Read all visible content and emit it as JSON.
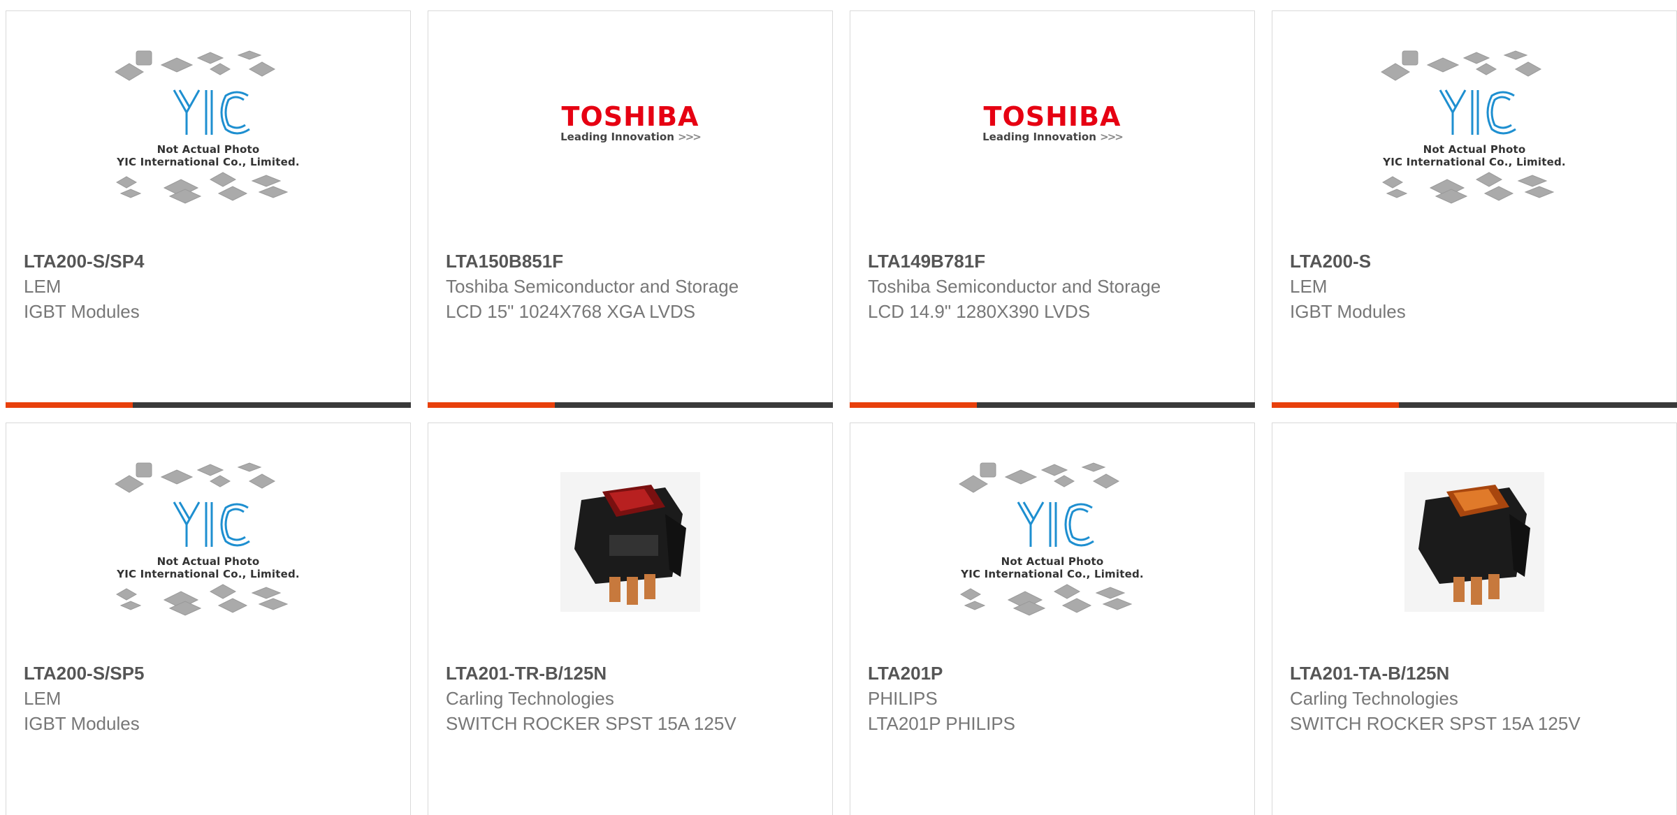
{
  "colors": {
    "accent": "#e8400c",
    "bar_dark": "#3a3a3a",
    "toshiba_red": "#e60012",
    "yic_blue": "#1e8fd0"
  },
  "placeholder": {
    "line1": "Not Actual Photo",
    "line2": "YIC International Co., Limited."
  },
  "toshiba_logo": {
    "brand": "TOSHIBA",
    "tagline": "Leading Innovation",
    "chevrons": ">>>"
  },
  "products": [
    {
      "part": "LTA200-S/SP4",
      "manufacturer": "LEM",
      "description": "IGBT Modules",
      "image": "yic-placeholder"
    },
    {
      "part": "LTA150B851F",
      "manufacturer": "Toshiba Semiconductor and Storage",
      "description": "LCD 15\" 1024X768 XGA LVDS",
      "image": "toshiba-logo"
    },
    {
      "part": "LTA149B781F",
      "manufacturer": "Toshiba Semiconductor and Storage",
      "description": "LCD 14.9\" 1280X390 LVDS",
      "image": "toshiba-logo"
    },
    {
      "part": "LTA200-S",
      "manufacturer": "LEM",
      "description": "IGBT Modules",
      "image": "yic-placeholder"
    },
    {
      "part": "LTA200-S/SP5",
      "manufacturer": "LEM",
      "description": "IGBT Modules",
      "image": "yic-placeholder"
    },
    {
      "part": "LTA201-TR-B/125N",
      "manufacturer": "Carling Technologies",
      "description": "SWITCH ROCKER SPST 15A 125V",
      "image": "rocker-switch-red"
    },
    {
      "part": "LTA201P",
      "manufacturer": "PHILIPS",
      "description": "LTA201P PHILIPS",
      "image": "yic-placeholder"
    },
    {
      "part": "LTA201-TA-B/125N",
      "manufacturer": "Carling Technologies",
      "description": "SWITCH ROCKER SPST 15A 125V",
      "image": "rocker-switch-amber"
    }
  ]
}
